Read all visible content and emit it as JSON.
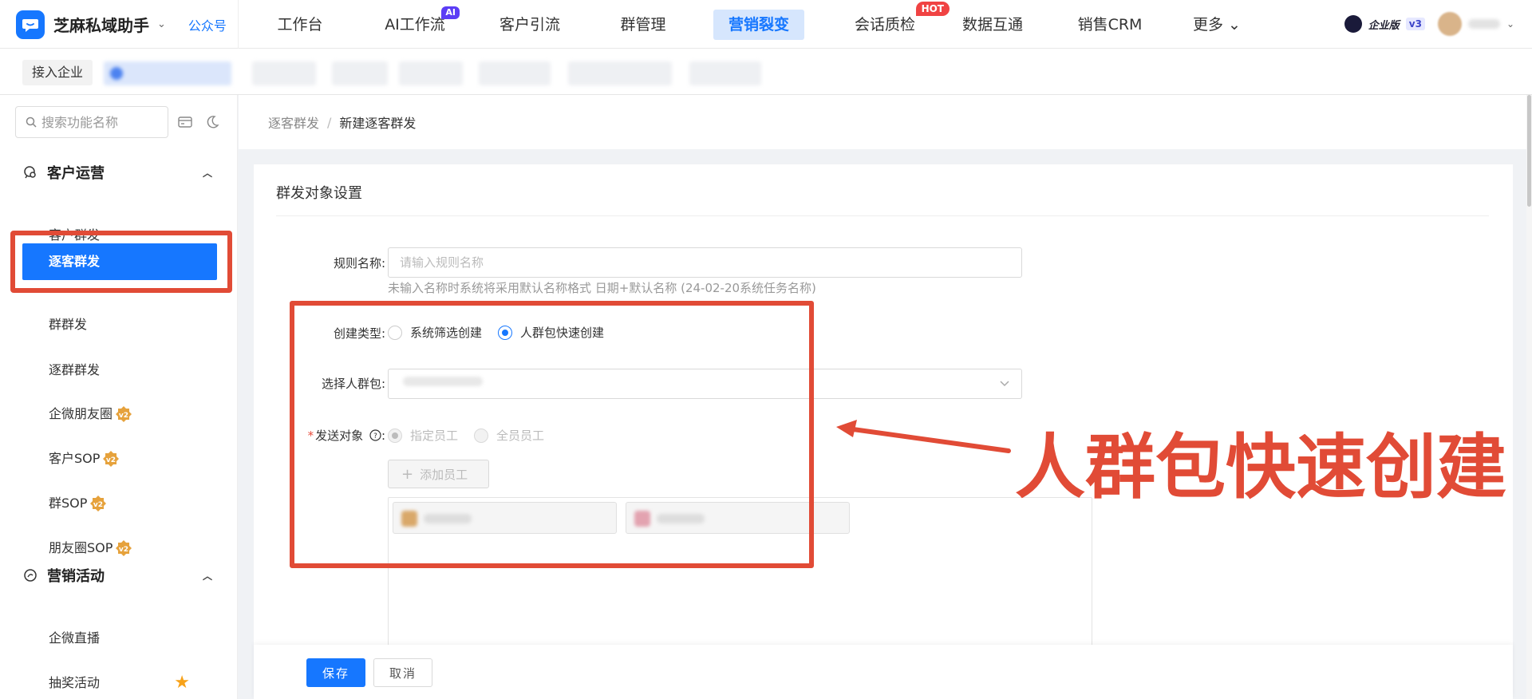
{
  "topnav": {
    "brand_name": "芝麻私域助手",
    "brand_caret": "⌄",
    "gzh_label": "公众号",
    "items": [
      {
        "label": "工作台"
      },
      {
        "label": "AI工作流",
        "badge": "AI"
      },
      {
        "label": "客户引流"
      },
      {
        "label": "群管理"
      },
      {
        "label": "营销裂变",
        "active": true
      },
      {
        "label": "会话质检",
        "badge": "HOT"
      },
      {
        "label": "数据互通"
      },
      {
        "label": "销售CRM"
      },
      {
        "label": "更多 ⌄"
      }
    ],
    "edition_label": "企业版",
    "edition_version": "v3"
  },
  "subnav": {
    "join_label": "接入企业"
  },
  "sidebar": {
    "search_placeholder": "搜索功能名称",
    "groups": [
      {
        "title": "客户运营",
        "items": [
          {
            "label": "客户群发"
          },
          {
            "label": "逐客群发",
            "active": true
          },
          {
            "label": "群群发"
          },
          {
            "label": "逐群群发"
          },
          {
            "label": "企微朋友圈",
            "badge": "v2"
          },
          {
            "label": "客户SOP",
            "badge": "v2"
          },
          {
            "label": "群SOP",
            "badge": "v2"
          },
          {
            "label": "朋友圈SOP",
            "badge": "v2"
          }
        ]
      },
      {
        "title": "营销活动",
        "items": [
          {
            "label": "企微直播"
          },
          {
            "label": "抽奖活动",
            "star": true
          }
        ]
      }
    ]
  },
  "breadcrumb": {
    "parent": "逐客群发",
    "separator": "/",
    "current": "新建逐客群发"
  },
  "form": {
    "section_title": "群发对象设置",
    "rule_name": {
      "label": "规则名称:",
      "placeholder": "请输入规则名称",
      "value": "",
      "hint": "未输入名称时系统将采用默认名称格式 日期+默认名称 (24-02-20系统任务名称)"
    },
    "create_type": {
      "label": "创建类型:",
      "options": [
        {
          "label": "系统筛选创建",
          "checked": false
        },
        {
          "label": "人群包快速创建",
          "checked": true
        }
      ]
    },
    "crowd_pack": {
      "label": "选择人群包:"
    },
    "send_target": {
      "required_mark": "*",
      "label": "发送对象",
      "help_icon": "question-circle-icon",
      "colon": ":",
      "options": [
        {
          "label": "指定员工",
          "checked": true,
          "disabled": true
        },
        {
          "label": "全员员工",
          "checked": false,
          "disabled": true
        }
      ],
      "add_button": "添加员工",
      "staff_avatar_colors": [
        "#d9a86a",
        "#e3a3b0"
      ]
    }
  },
  "annotation": {
    "text": "人群包快速创建",
    "color": "#e14b36"
  },
  "footer": {
    "save_label": "保存",
    "cancel_label": "取消"
  },
  "colors": {
    "primary": "#1677ff",
    "annotation_red": "#e14b36",
    "badge_ai": "#5b3df5",
    "badge_hot": "#f04343",
    "star": "#f7a21a",
    "v2_badge": "#e6a23c"
  }
}
